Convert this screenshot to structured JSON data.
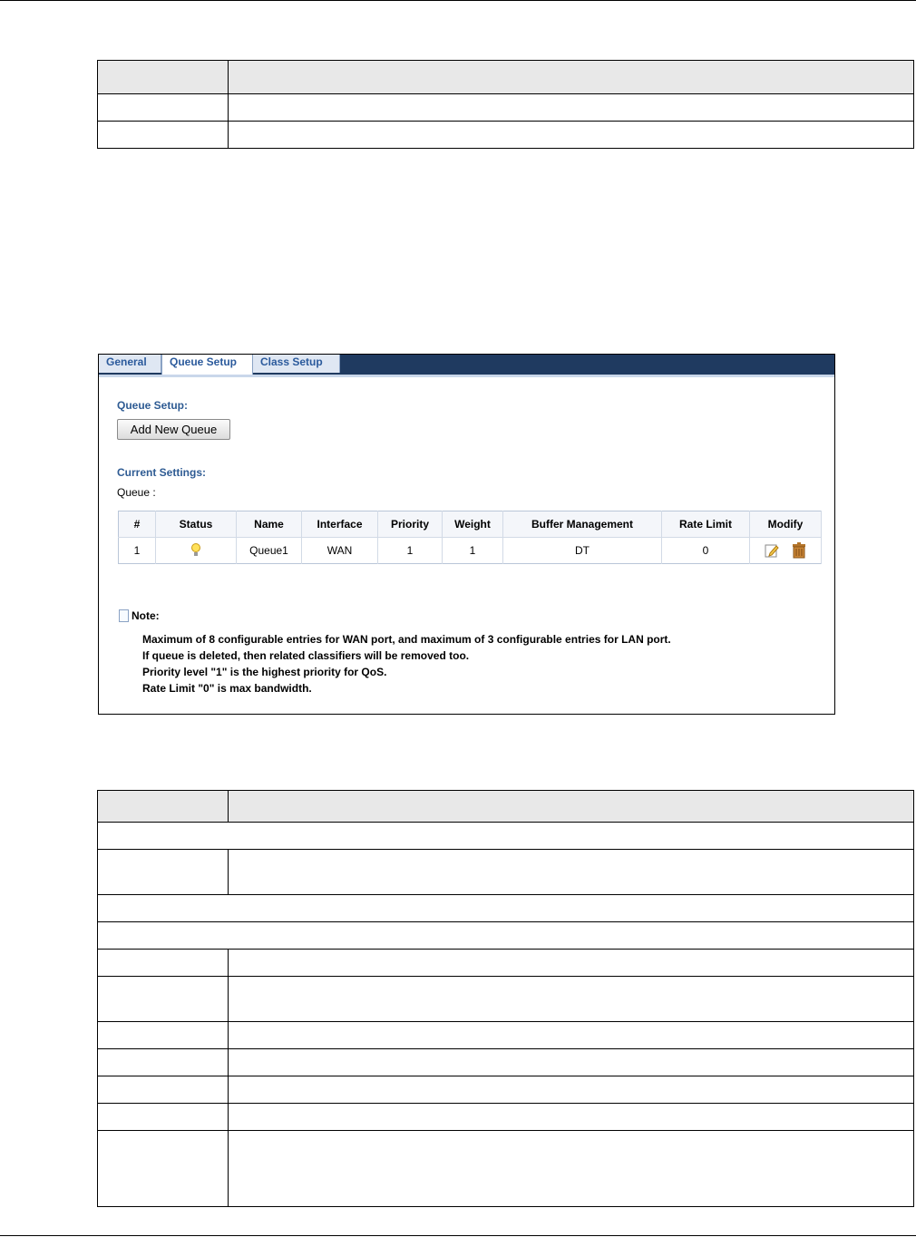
{
  "queue_setup": {
    "tabs": [
      {
        "label": "General"
      },
      {
        "label": "Queue Setup"
      },
      {
        "label": "Class Setup"
      }
    ],
    "section_title": "Queue Setup:",
    "add_button": "Add New Queue",
    "current_settings_title": "Current Settings:",
    "queue_label": "Queue :",
    "columns": [
      "#",
      "Status",
      "Name",
      "Interface",
      "Priority",
      "Weight",
      "Buffer Management",
      "Rate Limit",
      "Modify"
    ],
    "rows": [
      {
        "index": "1",
        "status_icon": "bulb-icon",
        "name": "Queue1",
        "interface": "WAN",
        "priority": "1",
        "weight": "1",
        "buffer": "DT",
        "rate_limit": "0"
      }
    ],
    "note_title": "Note:",
    "note_lines": [
      "Maximum of 8 configurable entries for WAN port, and maximum of 3 configurable entries for LAN port.",
      "If queue is deleted, then related classifiers will be removed too.",
      "Priority level \"1\" is the highest priority for QoS.",
      "Rate Limit \"0\" is max bandwidth."
    ],
    "colors": {
      "tab_bar": "#1f3a60",
      "section_text": "#2e5b93",
      "bulb": "#ffe15a"
    }
  }
}
